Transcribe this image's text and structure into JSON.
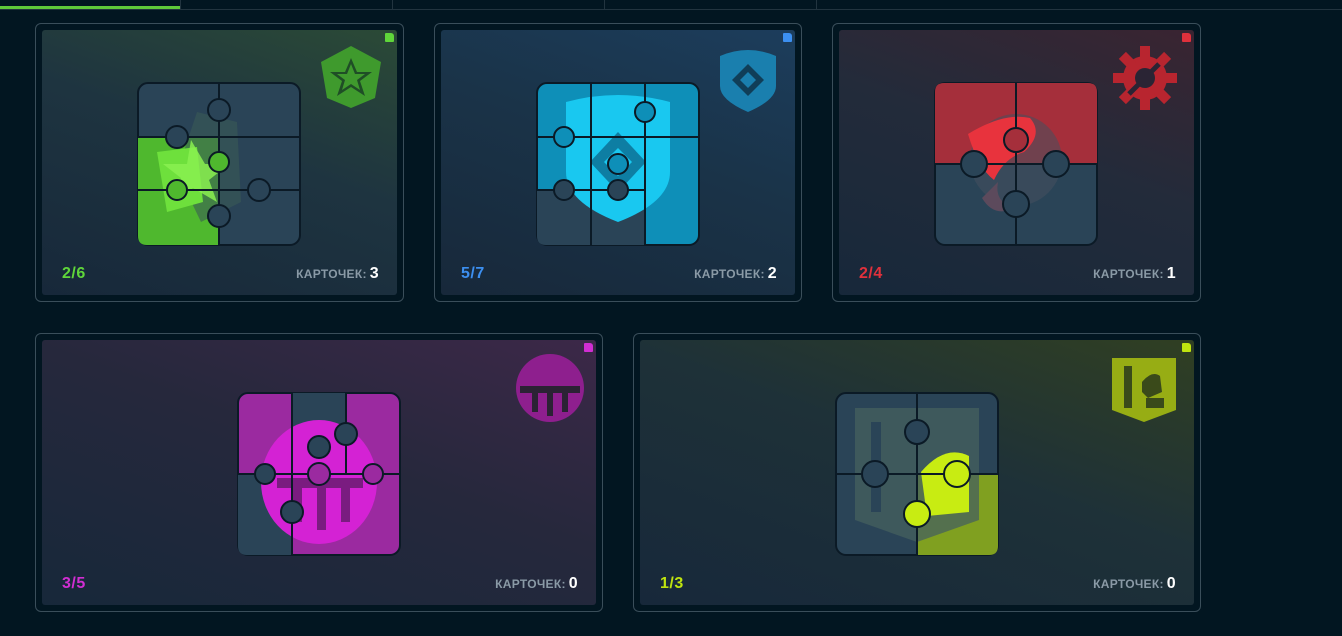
{
  "count_label": "КАРТОЧЕК:",
  "cards": [
    {
      "progress": "2/6",
      "count": "3",
      "color": "#5fd63a",
      "icon": "star-shield-icon"
    },
    {
      "progress": "5/7",
      "count": "2",
      "color": "#3c8ff0",
      "icon": "eye-shield-icon"
    },
    {
      "progress": "2/4",
      "count": "1",
      "color": "#e0313c",
      "icon": "gear-icon"
    },
    {
      "progress": "3/5",
      "count": "0",
      "color": "#d12ed2",
      "icon": "trident-emblem-icon"
    },
    {
      "progress": "1/3",
      "count": "0",
      "color": "#bfe30f",
      "icon": "fist-shield-icon"
    }
  ]
}
